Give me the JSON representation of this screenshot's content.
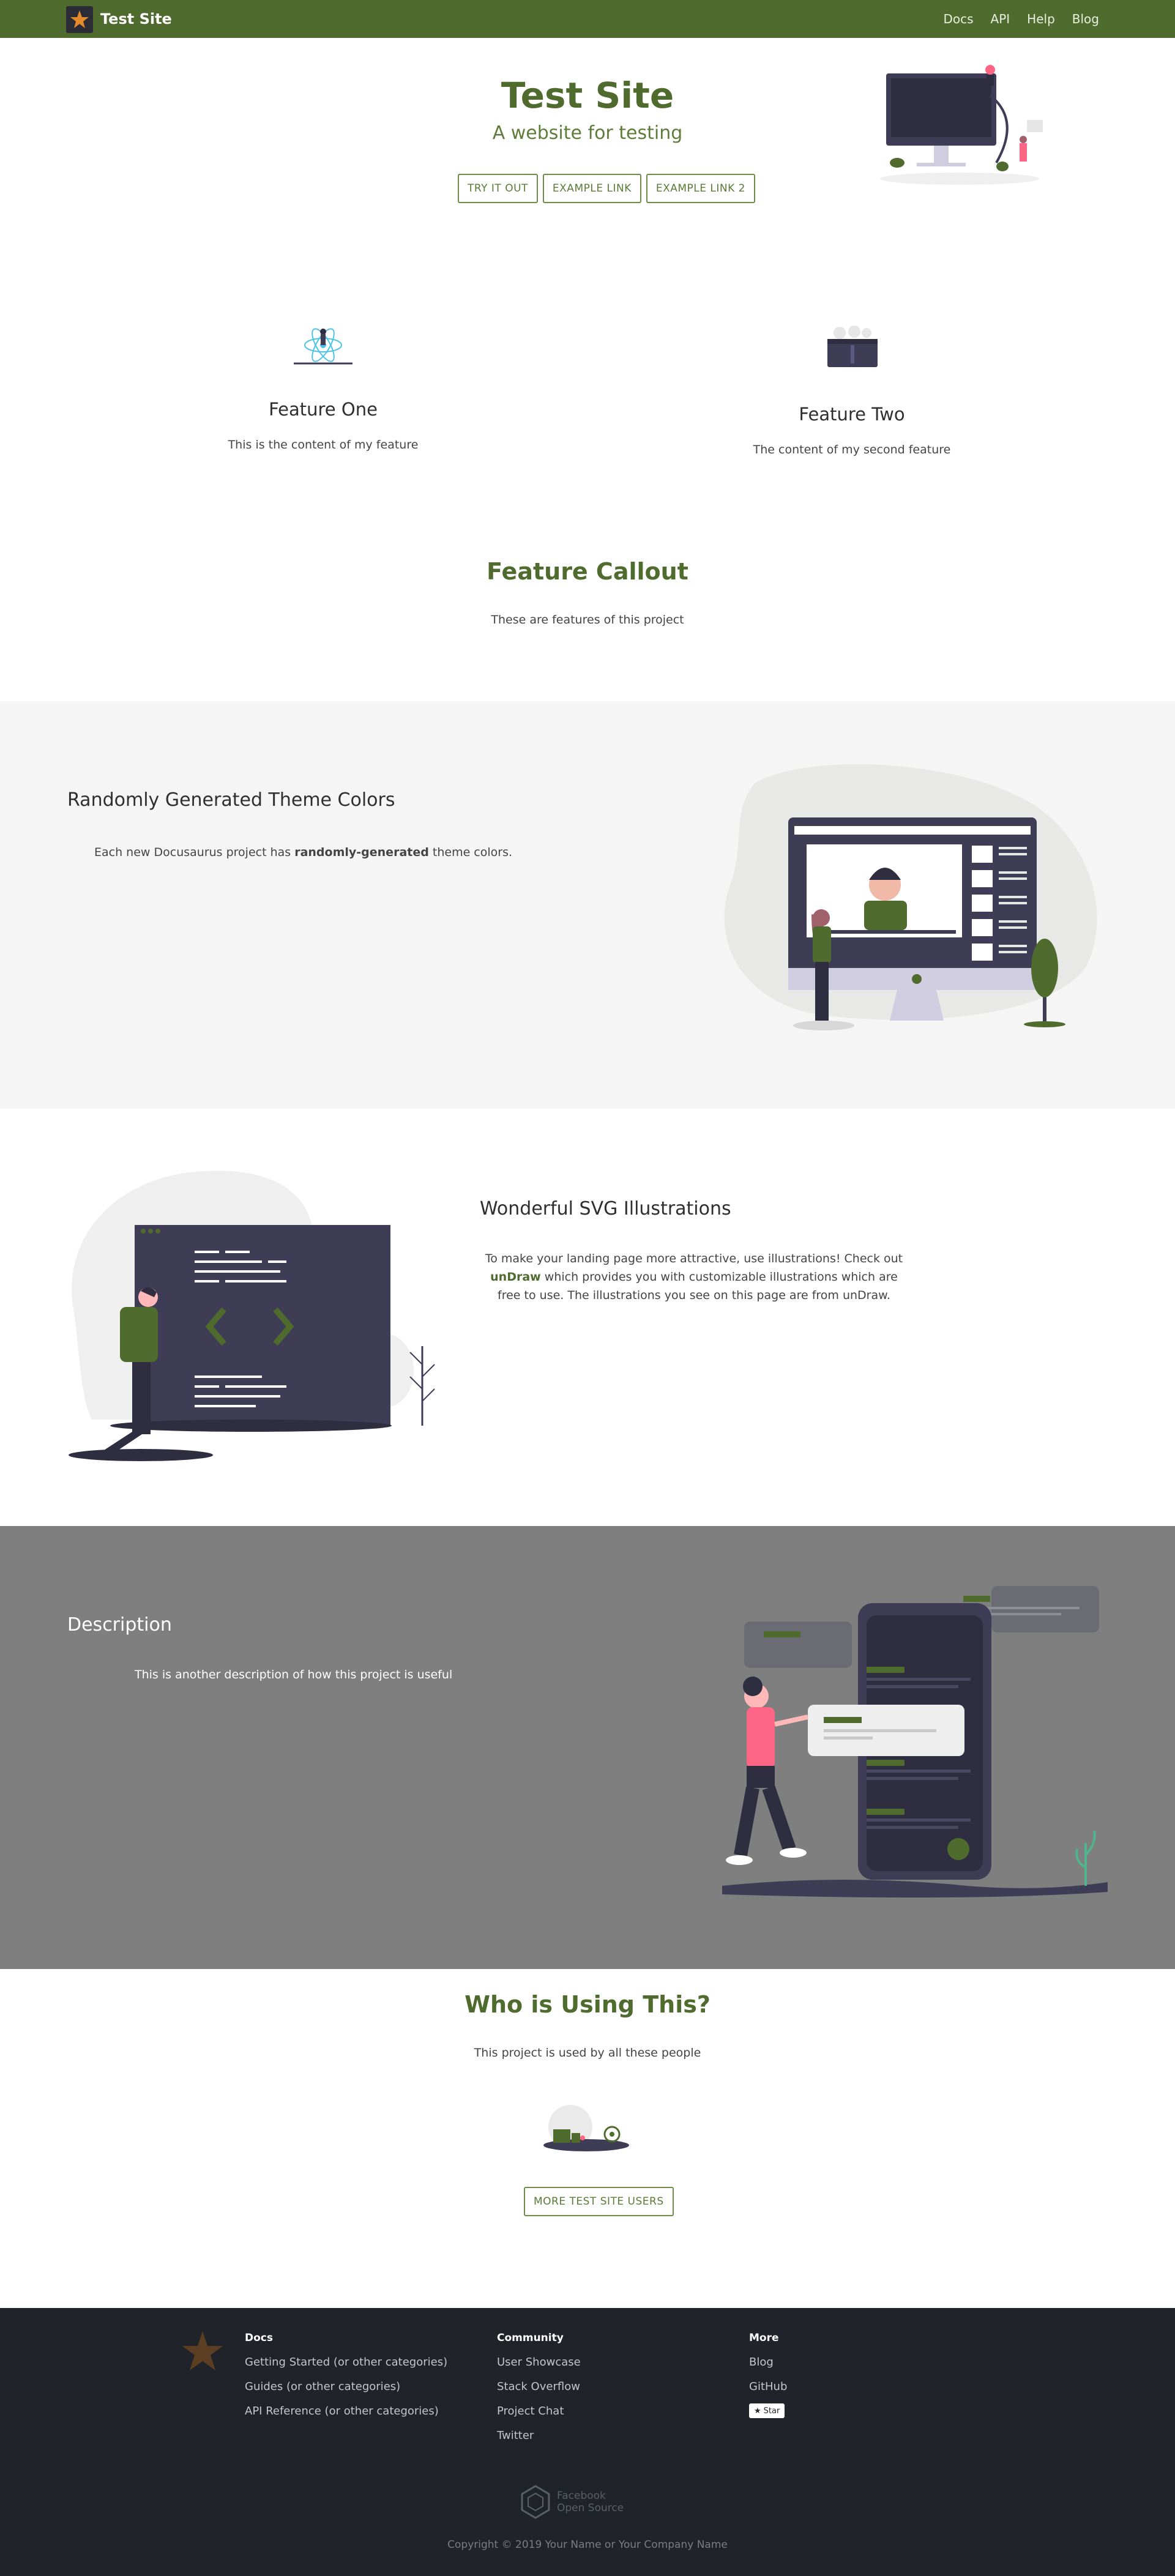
{
  "nav": {
    "title": "Test Site",
    "links": [
      "Docs",
      "API",
      "Help",
      "Blog"
    ]
  },
  "hero": {
    "title": "Test Site",
    "tagline": "A website for testing",
    "buttons": [
      "TRY IT OUT",
      "EXAMPLE LINK",
      "EXAMPLE LINK 2"
    ]
  },
  "features": [
    {
      "title": "Feature One",
      "body": "This is the content of my feature",
      "icon": "react-atom-icon"
    },
    {
      "title": "Feature Two",
      "body": "The content of my second feature",
      "icon": "server-icon"
    }
  ],
  "callout": {
    "title": "Feature Callout",
    "body": "These are features of this project"
  },
  "section_theme": {
    "title": "Randomly Generated Theme Colors",
    "body_pre": "Each new Docusaurus project has ",
    "body_bold": "randomly-generated",
    "body_post": " theme colors."
  },
  "section_svg": {
    "title": "Wonderful SVG Illustrations",
    "body_pre": "To make your landing page more attractive, use illustrations! Check out ",
    "body_link": "unDraw",
    "body_post": " which provides you with customizable illustrations which are free to use. The illustrations you see on this page are from unDraw."
  },
  "section_desc": {
    "title": "Description",
    "body": "This is another description of how this project is useful"
  },
  "users": {
    "title": "Who is Using This?",
    "body": "This project is used by all these people",
    "button": "MORE TEST SITE USERS"
  },
  "footer": {
    "columns": [
      {
        "heading": "Docs",
        "links": [
          "Getting Started (or other categories)",
          "Guides (or other categories)",
          "API Reference (or other categories)"
        ]
      },
      {
        "heading": "Community",
        "links": [
          "User Showcase",
          "Stack Overflow",
          "Project Chat",
          "Twitter"
        ]
      },
      {
        "heading": "More",
        "links": [
          "Blog",
          "GitHub"
        ],
        "star_label": "Star"
      }
    ],
    "oss_line1": "Facebook",
    "oss_line2": "Open Source",
    "copyright": "Copyright © 2019 Your Name or Your Company Name"
  },
  "colors": {
    "primary": "#4f6b2e",
    "footer_bg": "#20232a",
    "light_section": "#f5f5f5",
    "dark_section": "#7f7f7f"
  }
}
